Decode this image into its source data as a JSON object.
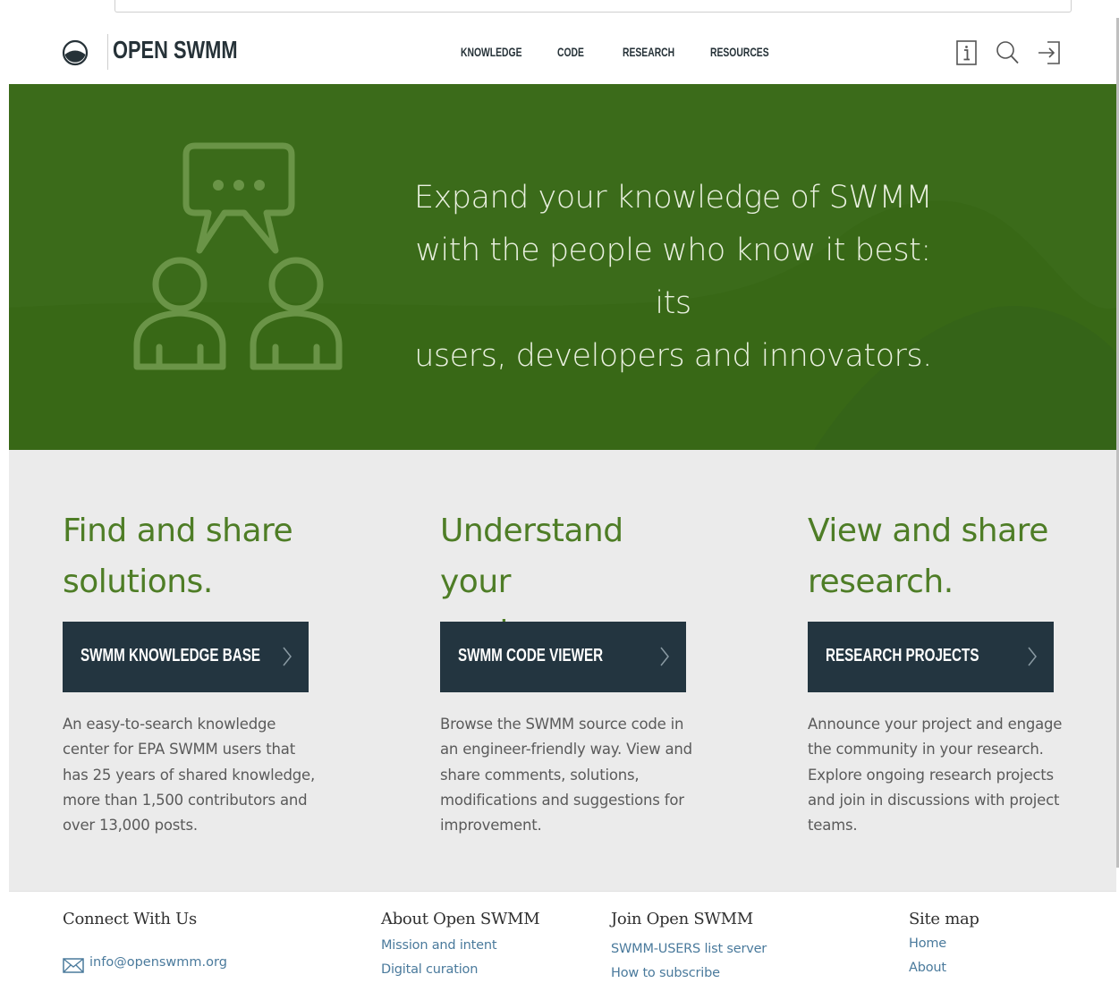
{
  "header": {
    "brand": "OPEN SWMM",
    "nav": [
      {
        "label": "KNOWLEDGE"
      },
      {
        "label": "CODE"
      },
      {
        "label": "RESEARCH"
      },
      {
        "label": "RESOURCES"
      }
    ],
    "icons": [
      "info-icon",
      "search-icon",
      "login-icon"
    ]
  },
  "hero": {
    "headline_lines": [
      "Expand your knowledge of SWMM",
      "with the people who know it best: its",
      "users, developers and innovators."
    ],
    "illustration": "people-conversation-icon",
    "background_color": "#3b6b1a"
  },
  "features": [
    {
      "title_lines": [
        "Find and share",
        "solutions."
      ],
      "button": "SWMM KNOWLEDGE BASE",
      "description": "An easy-to-search knowledge center for EPA SWMM users that has 25 years of shared knowledge, more than 1,500 contributors and over 13,000 posts."
    },
    {
      "title_lines": [
        "Understand your",
        "engine."
      ],
      "button": "SWMM CODE VIEWER",
      "description": "Browse the SWMM source code in an engineer-friendly way. View and share comments, solutions, modifications and suggestions for improvement."
    },
    {
      "title_lines": [
        "View and share",
        "research."
      ],
      "button": "RESEARCH PROJECTS",
      "description": "Announce your project and engage the community in your research. Explore ongoing research projects and join in discussions with project teams."
    }
  ],
  "footer": {
    "connect": {
      "heading": "Connect With Us",
      "email": "info@openswmm.org"
    },
    "about": {
      "heading": "About Open SWMM",
      "links": [
        "Mission and intent",
        "Digital curation"
      ]
    },
    "join": {
      "heading": "Join Open SWMM",
      "links": [
        "SWMM-USERS list server",
        "How to subscribe"
      ]
    },
    "sitemap": {
      "heading": "Site map",
      "links": [
        "Home",
        "About"
      ]
    }
  },
  "colors": {
    "accent_green": "#4e7d26",
    "hero_green": "#3b6b1a",
    "button_dark": "#233540",
    "link_blue": "#4a7a9c"
  }
}
